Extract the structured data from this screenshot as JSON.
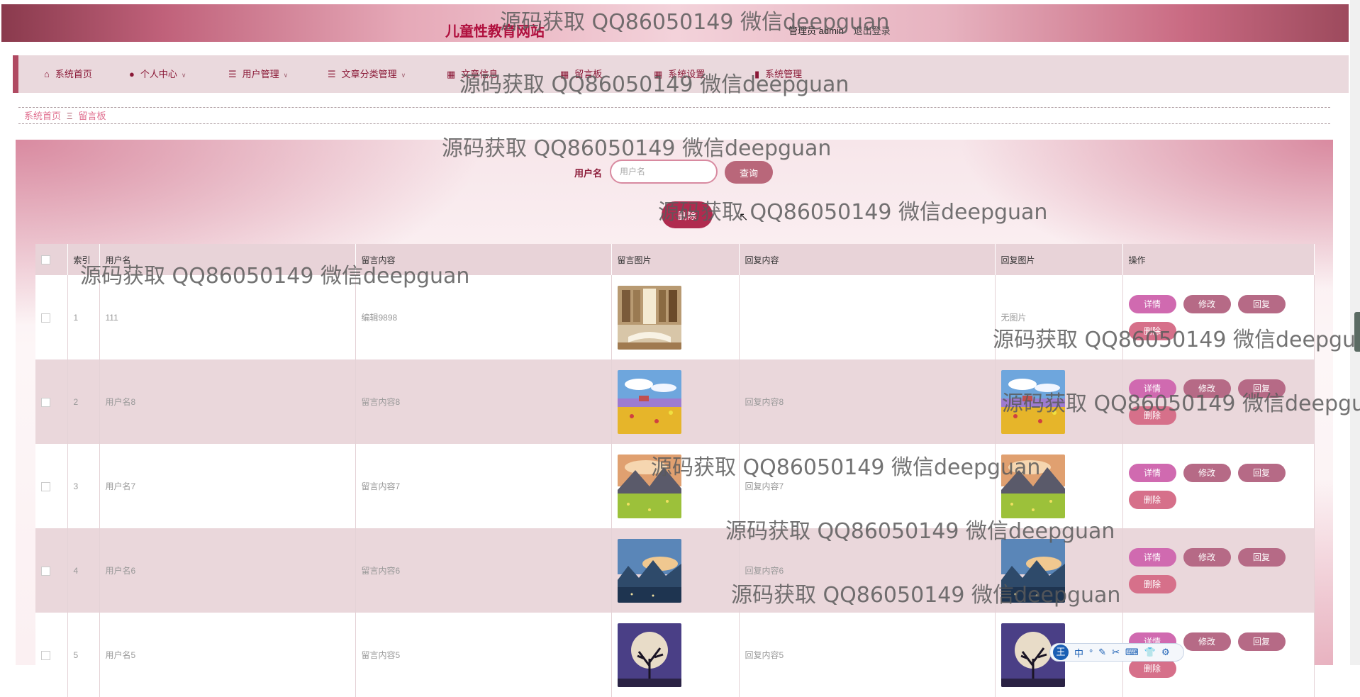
{
  "header": {
    "site_title": "儿童性教育网站",
    "user_label": "管理员 admin",
    "logout_label": "退出登录"
  },
  "nav": {
    "items": [
      {
        "label": "系统首页",
        "icon": "home-icon"
      },
      {
        "label": "个人中心",
        "icon": "user-icon",
        "dropdown": true
      },
      {
        "label": "用户管理",
        "icon": "list-icon",
        "dropdown": true
      },
      {
        "label": "文章分类管理",
        "icon": "list-icon",
        "dropdown": true
      },
      {
        "label": "文章信息",
        "icon": "grid-icon"
      },
      {
        "label": "留言板",
        "icon": "grid-icon"
      },
      {
        "label": "系统设置",
        "icon": "grid-icon"
      },
      {
        "label": "系统管理",
        "icon": "bookmark-icon"
      }
    ]
  },
  "breadcrumb": {
    "home": "系统首页",
    "separator": "Ξ",
    "current": "留言板"
  },
  "search": {
    "label": "用户名",
    "placeholder": "用户名",
    "query_button": "查询",
    "delete_button": "删除"
  },
  "table": {
    "columns": [
      "",
      "索引",
      "用户名",
      "留言内容",
      "留言图片",
      "回复内容",
      "回复图片",
      "操作"
    ],
    "rows": [
      {
        "index": "1",
        "username": "111",
        "content": "编辑9898",
        "image": "library-book",
        "reply": "",
        "reply_image": null,
        "no_image_text": "无图片",
        "has_delete": false
      },
      {
        "index": "2",
        "username": "用户名8",
        "content": "留言内容8",
        "image": "flower-field",
        "reply": "回复内容8",
        "reply_image": "flower-field",
        "has_delete": true
      },
      {
        "index": "3",
        "username": "用户名7",
        "content": "留言内容7",
        "image": "mountain-meadow",
        "reply": "回复内容7",
        "reply_image": "mountain-meadow",
        "has_delete": true
      },
      {
        "index": "4",
        "username": "用户名6",
        "content": "留言内容6",
        "image": "blue-mountains",
        "reply": "回复内容6",
        "reply_image": "blue-mountains",
        "has_delete": true
      },
      {
        "index": "5",
        "username": "用户名5",
        "content": "留言内容5",
        "image": "moon-tree",
        "reply": "回复内容5",
        "reply_image": "moon-tree",
        "has_delete": true
      }
    ],
    "actions": {
      "detail": "详情",
      "edit": "修改",
      "reply": "回复",
      "delete": "删除"
    }
  },
  "watermark": "源码获取 QQ86050149 微信deepguan",
  "ime": {
    "logo": "王",
    "items": [
      "中",
      "°",
      "✎",
      "✂",
      "⌨",
      "👕",
      "⚙"
    ]
  },
  "colors": {
    "brand": "#b0103e",
    "nav_bg": "#ead9dd",
    "query_button": "#b9677a",
    "delete_button": "#b02b4f",
    "detail_button": "#d06ab0",
    "edit_button": "#b66a86"
  }
}
